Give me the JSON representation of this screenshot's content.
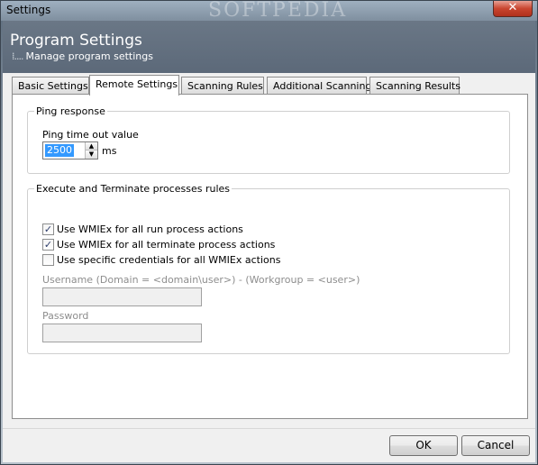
{
  "window": {
    "title": "Settings",
    "watermark": "SOFTPEDIA"
  },
  "header": {
    "title": "Program Settings",
    "subtitle": "Manage program settings"
  },
  "tabs": [
    {
      "label": "Basic Settings"
    },
    {
      "label": "Remote Settings"
    },
    {
      "label": "Scanning Rules"
    },
    {
      "label": "Additional Scanning"
    },
    {
      "label": "Scanning Results"
    }
  ],
  "ping": {
    "group_label": "Ping response",
    "field_label": "Ping time out value",
    "value": "2500",
    "unit": "ms"
  },
  "execute": {
    "group_label": "Execute and Terminate processes rules",
    "options": [
      {
        "label": "Use WMIEx for all run process actions",
        "checked": true
      },
      {
        "label": "Use WMIEx for all terminate process actions",
        "checked": true
      },
      {
        "label": "Use specific credentials for all WMIEx actions",
        "checked": false
      }
    ],
    "username_label": "Username (Domain = <domain\\user>) - (Workgroup = <user>)",
    "username_value": "",
    "password_label": "Password",
    "password_value": ""
  },
  "buttons": {
    "ok": "OK",
    "cancel": "Cancel"
  }
}
